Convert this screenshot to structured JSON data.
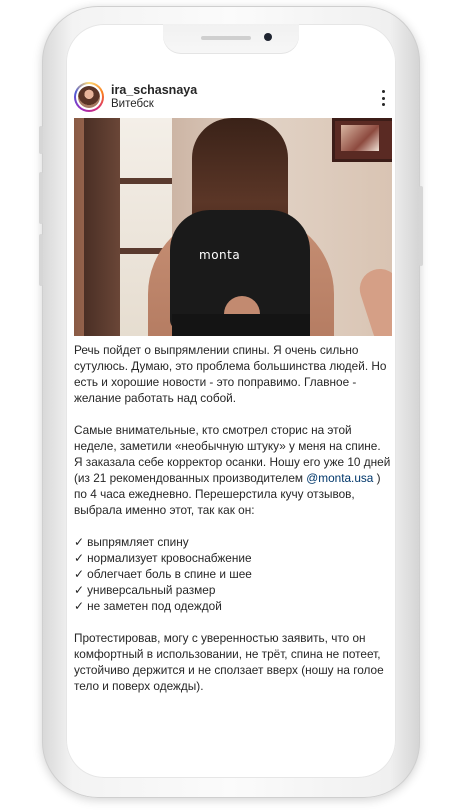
{
  "post": {
    "username": "ira_schasnaya",
    "location": "Витебск",
    "image_brand_text": "monta",
    "caption": {
      "p1": "Речь пойдет о выпрямлении спины. Я очень сильно сутулюсь. Думаю, это проблема большинства людей. Но есть и хорошие новости - это поправимо. Главное - желание работать над собой.",
      "p2_before": "Самые внимательные, кто смотрел сторис на этой неделе, заметили «необычную штуку» у меня на спине. Я заказала себе корректор осанки. Ношу его уже 10 дней (из 21 рекомендованных производителем ",
      "p2_mention": "@monta.usa",
      "p2_after": " ) по 4 часа ежедневно. Перешерстила кучу отзывов, выбрала именно этот, так как он:",
      "list": [
        "✓ выпрямляет спину",
        "✓ нормализует кровоснабжение",
        "✓ облегчает боль в спине и шее",
        "✓ универсальный размер",
        "✓ не заметен под одеждой"
      ],
      "p3": "Протестировав, могу с уверенностью заявить, что он комфортный в использовании, не трёт, спина не потеет, устойчиво держится и не сползает вверх (ношу на голое тело и поверх одежды)."
    }
  },
  "icons": {
    "more": "more-vertical-icon"
  },
  "colors": {
    "text": "#262626",
    "mention": "#00376b"
  }
}
